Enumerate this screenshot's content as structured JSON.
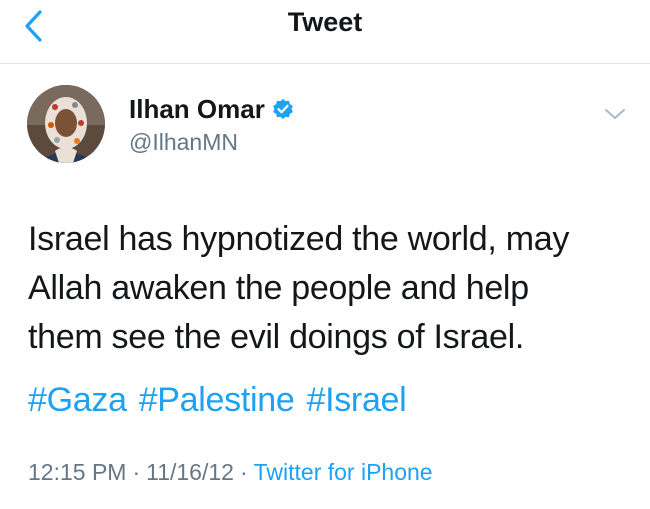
{
  "nav": {
    "title": "Tweet",
    "back_icon": "chevron-left-icon"
  },
  "author": {
    "name": "Ilhan Omar",
    "handle": "@IlhanMN",
    "verified_icon": "verified-badge-icon",
    "avatar": "profile-photo"
  },
  "tweet": {
    "lines": [
      "Israel has hypnotized the world, may",
      "Allah awaken the people and help",
      "them see the evil doings of Israel."
    ],
    "hashtags": [
      "#Gaza",
      "#Palestine",
      "#Israel"
    ]
  },
  "meta": {
    "time": "12:15 PM",
    "separator": "·",
    "date": "11/16/12",
    "source": "Twitter for iPhone"
  },
  "colors": {
    "link": "#1da1f2",
    "text": "#14171a",
    "secondary": "#657786",
    "border": "#e1e6ea"
  }
}
